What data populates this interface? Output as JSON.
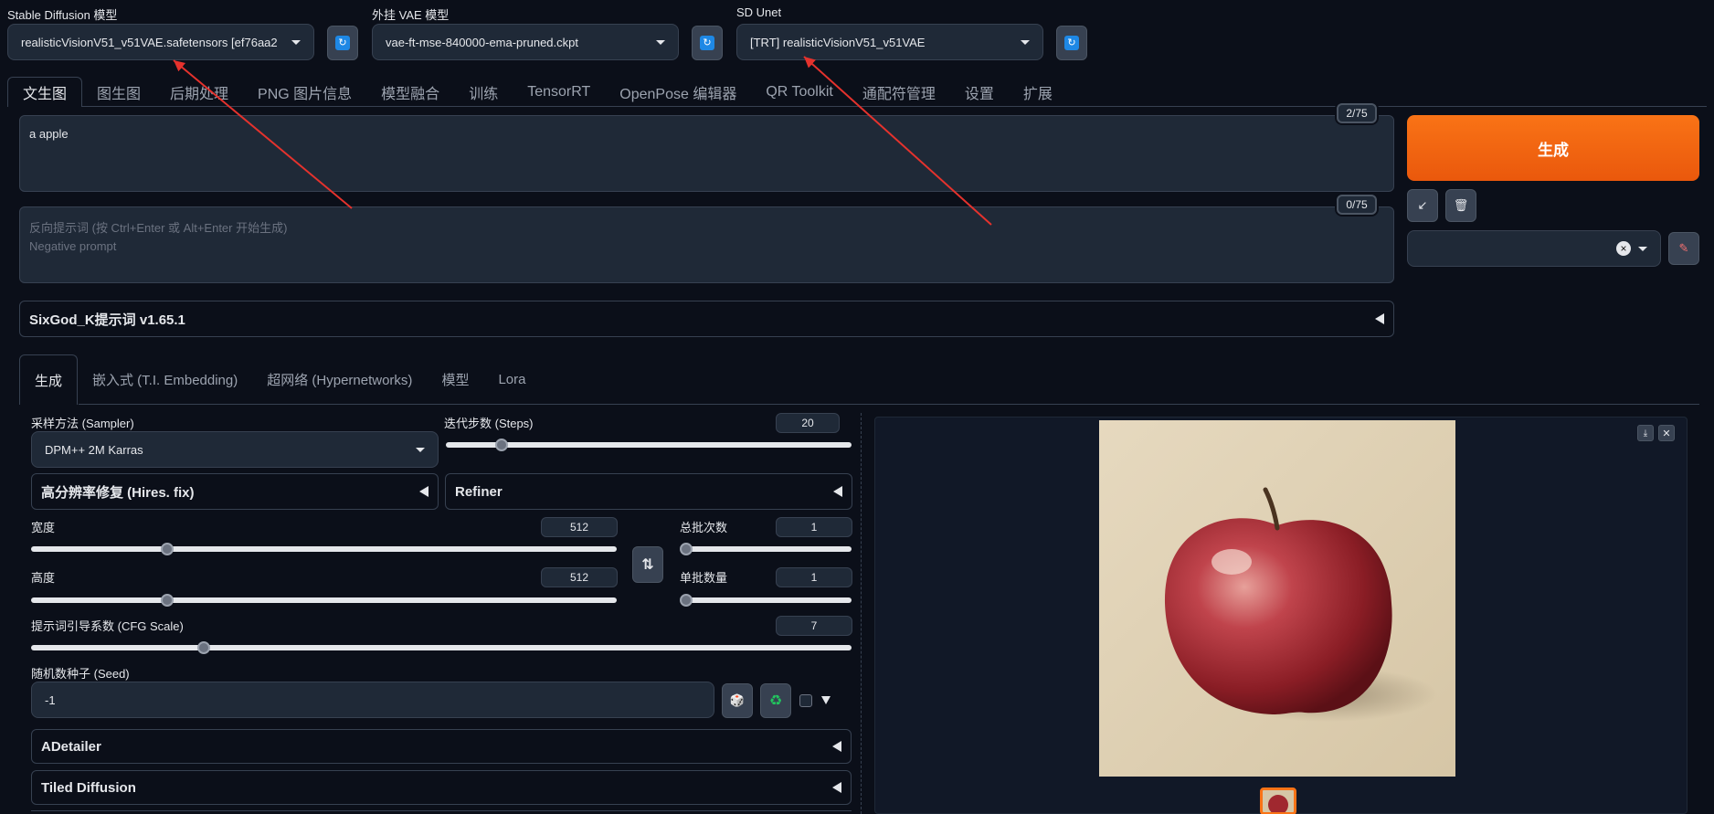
{
  "top": {
    "sd_model_label": "Stable Diffusion 模型",
    "sd_model_value": "realisticVisionV51_v51VAE.safetensors [ef76aa2",
    "vae_label": "外挂 VAE 模型",
    "vae_value": "vae-ft-mse-840000-ema-pruned.ckpt",
    "unet_label": "SD Unet",
    "unet_value": "[TRT] realisticVisionV51_v51VAE"
  },
  "main_tabs": [
    "文生图",
    "图生图",
    "后期处理",
    "PNG 图片信息",
    "模型融合",
    "训练",
    "TensorRT",
    "OpenPose 编辑器",
    "QR Toolkit",
    "通配符管理",
    "设置",
    "扩展"
  ],
  "prompt": {
    "value": "a apple",
    "counter": "2/75"
  },
  "negative": {
    "placeholder1": "反向提示词 (按 Ctrl+Enter 或 Alt+Enter 开始生成)",
    "placeholder2": "Negative prompt",
    "counter": "0/75"
  },
  "generate_label": "生成",
  "styles_clear": "×",
  "sixgod": "SixGod_K提示词 v1.65.1",
  "sub_tabs": [
    "生成",
    "嵌入式 (T.I. Embedding)",
    "超网络 (Hypernetworks)",
    "模型",
    "Lora"
  ],
  "params": {
    "sampler_label": "采样方法 (Sampler)",
    "sampler_value": "DPM++ 2M Karras",
    "steps_label": "迭代步数 (Steps)",
    "steps_value": "20",
    "steps_level": 0.2,
    "hires": "高分辨率修复 (Hires. fix)",
    "refiner": "Refiner",
    "width_label": "宽度",
    "width_value": "512",
    "height_label": "高度",
    "height_value": "512",
    "batch_count_label": "总批次数",
    "batch_count_value": "1",
    "batch_size_label": "单批数量",
    "batch_size_value": "1",
    "cfg_label": "提示词引导系数 (CFG Scale)",
    "cfg_value": "7",
    "seed_label": "随机数种子 (Seed)",
    "seed_value": "-1",
    "adetailer": "ADetailer",
    "tiled": "Tiled Diffusion"
  },
  "colors": {
    "accent": "#f97316",
    "bg": "#0b0f19",
    "panel": "#1f2937",
    "arrow": "#e5322d"
  },
  "icons": [
    "refresh-icon",
    "caret-down-icon",
    "swap-icon",
    "dice-icon",
    "recycle-icon",
    "download-icon",
    "close-icon",
    "trash-icon",
    "arrow-icon",
    "brush-icon"
  ]
}
